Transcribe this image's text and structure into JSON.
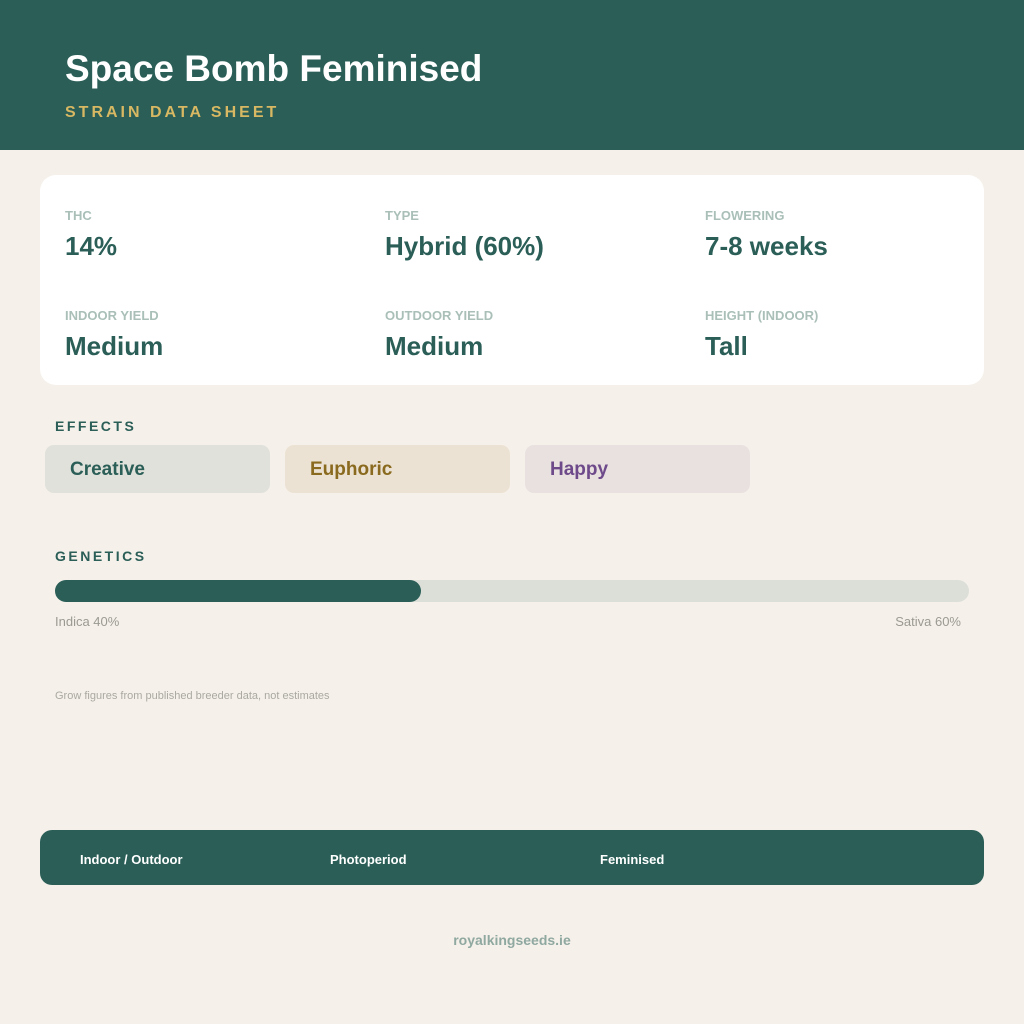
{
  "header": {
    "title": "Space Bomb Feminised",
    "subtitle": "STRAIN DATA SHEET"
  },
  "stats": {
    "thc": {
      "label": "THC",
      "value": "14%"
    },
    "type": {
      "label": "TYPE",
      "value": "Hybrid (60%)"
    },
    "flowering": {
      "label": "FLOWERING",
      "value": "7-8 weeks"
    },
    "indoor_yield": {
      "label": "INDOOR YIELD",
      "value": "Medium"
    },
    "outdoor_yield": {
      "label": "OUTDOOR YIELD",
      "value": "Medium"
    },
    "height": {
      "label": "HEIGHT (INDOOR)",
      "value": "Tall"
    }
  },
  "effects": {
    "label": "EFFECTS",
    "items": [
      {
        "label": "Creative",
        "bg": "#e0e1da",
        "fg": "#2a5e57"
      },
      {
        "label": "Euphoric",
        "bg": "#ece2d3",
        "fg": "#8a6a1e"
      },
      {
        "label": "Happy",
        "bg": "#e8e1e0",
        "fg": "#6e4a8a"
      }
    ]
  },
  "genetics": {
    "label": "GENETICS",
    "indica_percent": 40,
    "sativa_percent": 60,
    "indica_text": "Indica 40%",
    "sativa_text": "Sativa 60%"
  },
  "footnote": "Grow figures from published breeder data, not estimates",
  "features": {
    "environment": "Indoor / Outdoor",
    "light_cycle": "Photoperiod",
    "seed_type": "Feminised"
  },
  "site_url": "royalkingseeds.ie",
  "colors": {
    "brand": "#2a5e57",
    "accent": "#d8b862",
    "background": "#f5f0ea"
  }
}
